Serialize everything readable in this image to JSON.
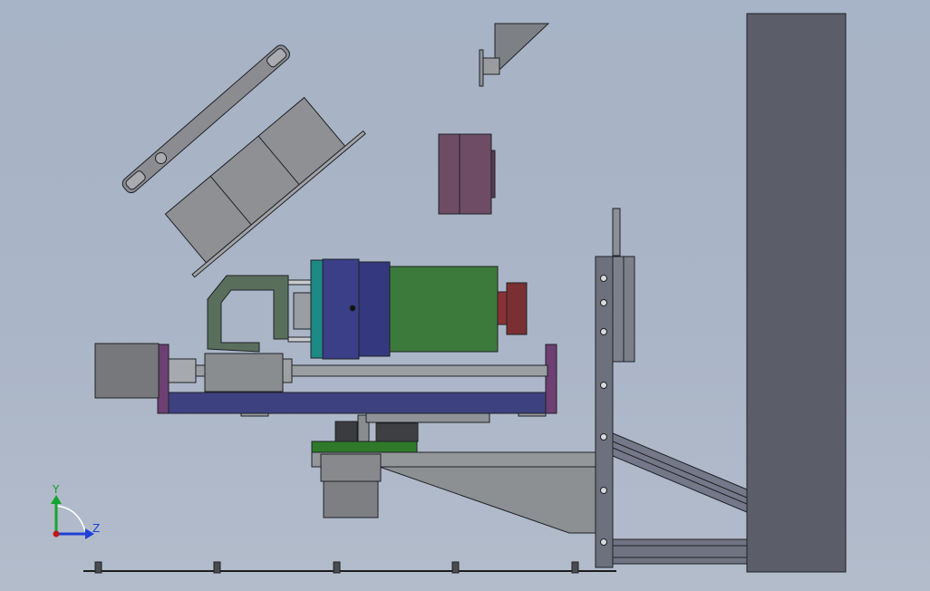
{
  "triad": {
    "y_label": "Y",
    "z_label": "Z",
    "y_color": "#15a52f",
    "z_color": "#1f3fd8",
    "origin_color": "#c01818"
  },
  "colors": {
    "background": "#a9b4c6",
    "outline": "#1f2226",
    "frame_plate": "#5b5e69",
    "gray_part": "#8f9296",
    "motor_blue": "#3b3f88",
    "motor_green": "#3c7a3c",
    "teal_ring": "#1d8a86",
    "brake_red": "#7a3033",
    "mauve_block": "#6e4c66",
    "violet_endplate": "#6d3f72",
    "rail_navy": "#3e4180",
    "pcb_green": "#2e7a2a",
    "bracket_green": "#5a6e5c"
  }
}
